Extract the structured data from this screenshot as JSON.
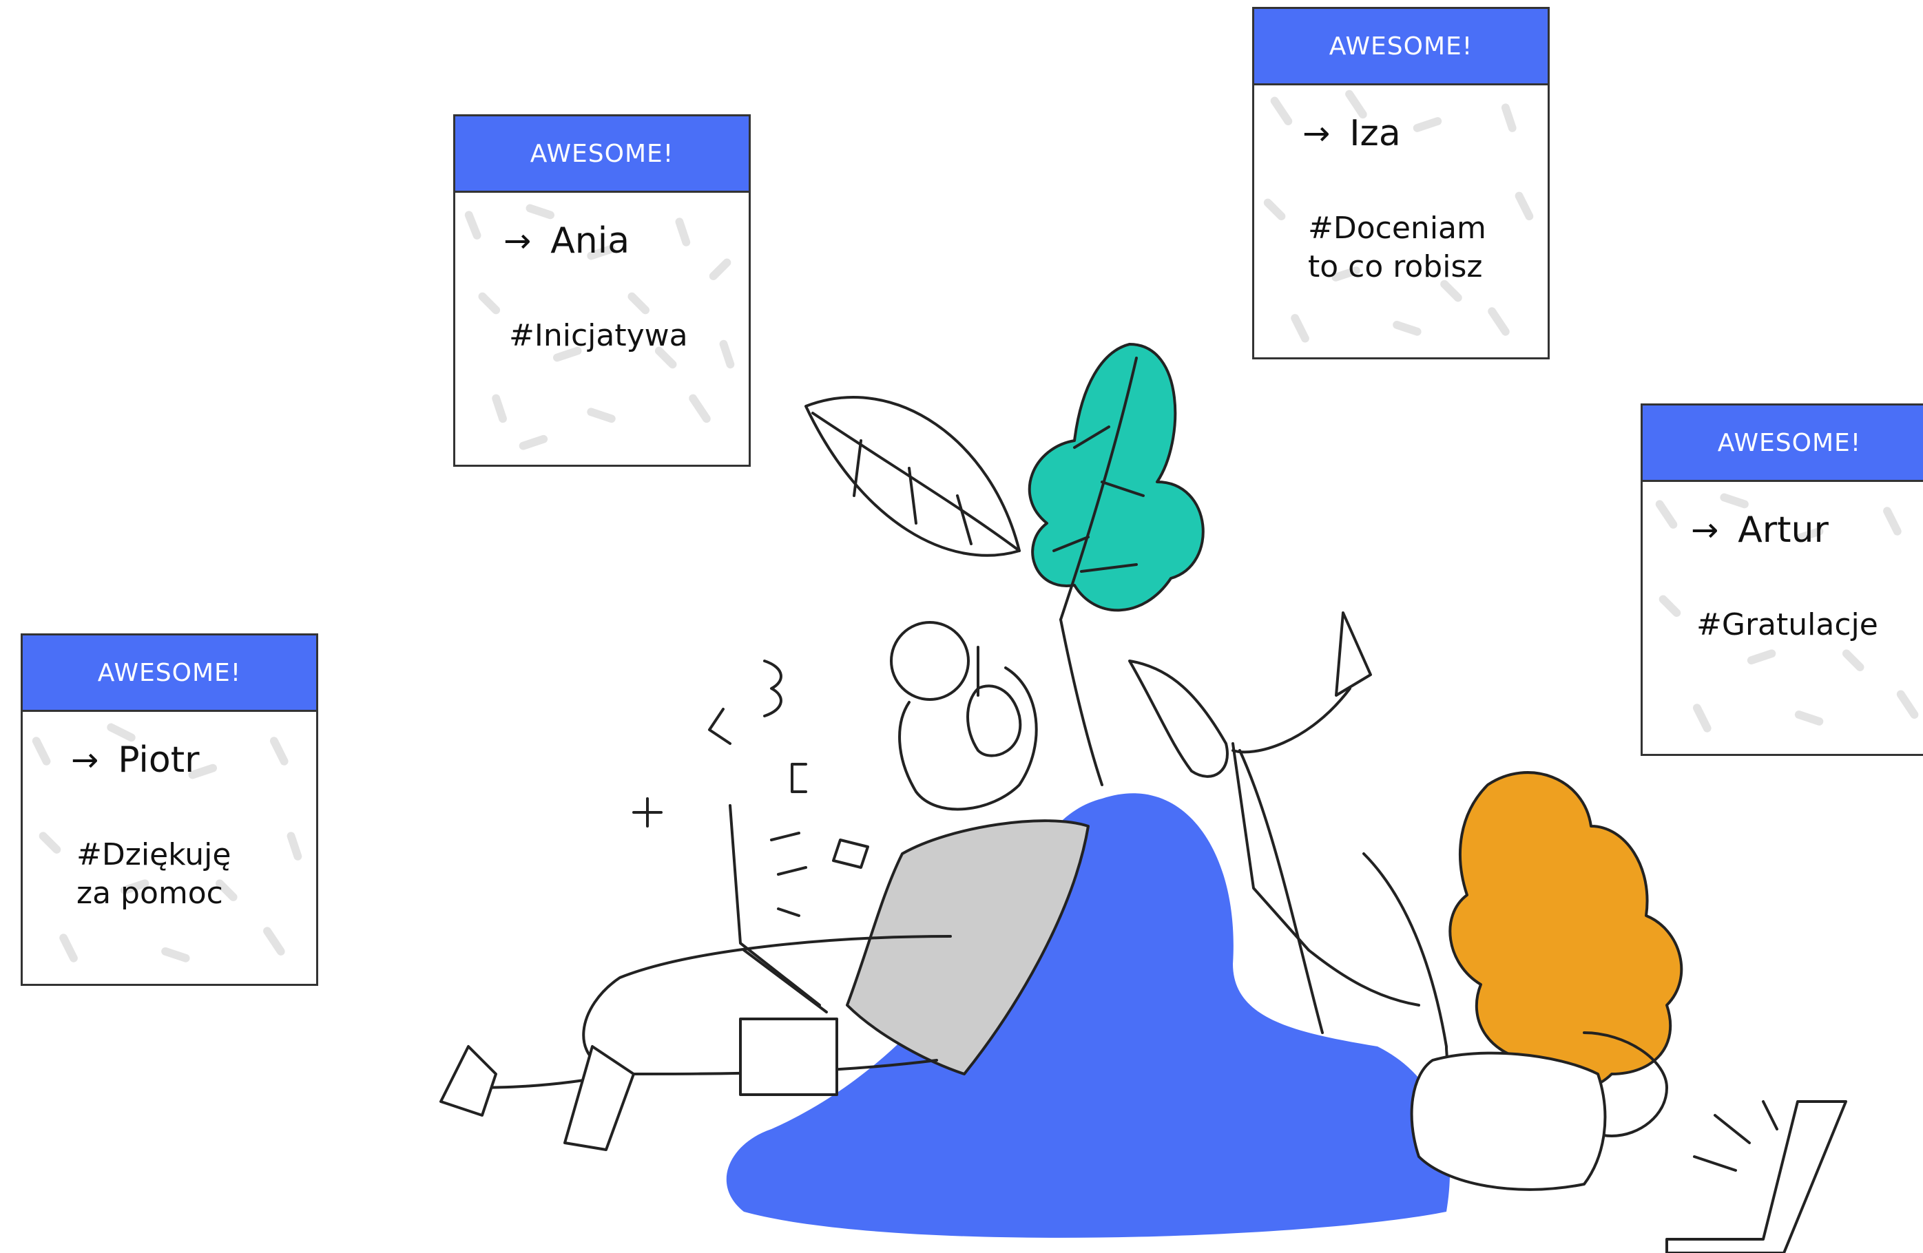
{
  "cards": [
    {
      "header": "AWESOME!",
      "name": "Ania",
      "tag": "#Inicjatywa"
    },
    {
      "header": "AWESOME!",
      "name": "Iza",
      "tag": "#Doceniam\nto co robisz"
    },
    {
      "header": "AWESOME!",
      "name": "Artur",
      "tag": "#Gratulacje"
    },
    {
      "header": "AWESOME!",
      "name": "Piotr",
      "tag": "#Dziękuję\nza pomoc"
    }
  ],
  "arrow": "→",
  "colors": {
    "header": "#4a6ff7",
    "beanbag": "#4a6ff7",
    "leaf": "#1fc8b1",
    "hair": "#eea020",
    "shirt": "#cccccc"
  }
}
